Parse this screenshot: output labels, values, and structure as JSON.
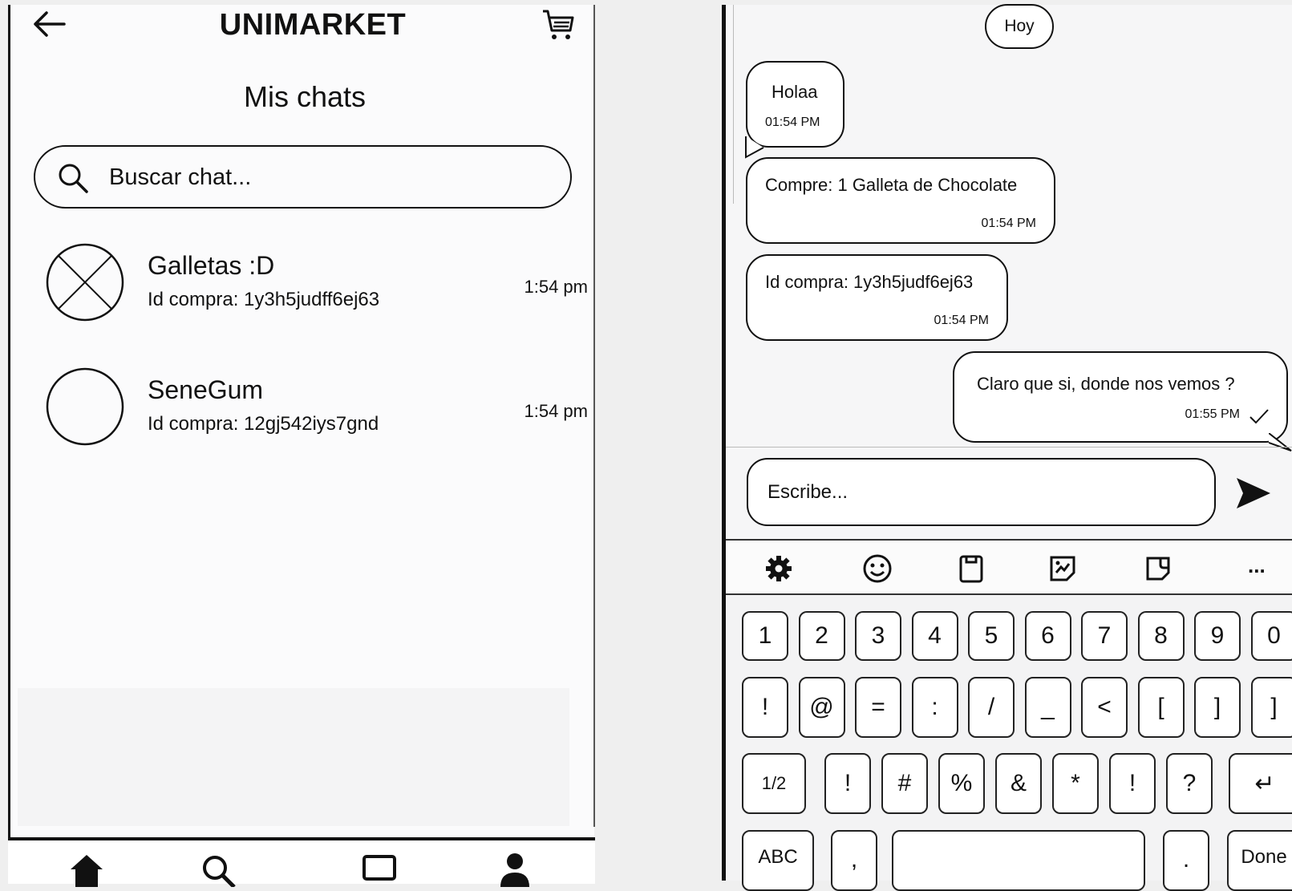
{
  "chat_list": {
    "app_title": "UNIMARKET",
    "page_title": "Mis chats",
    "search": {
      "placeholder": "Buscar chat..."
    },
    "chats": [
      {
        "name": "Galletas :D",
        "subtitle": "Id compra: 1y3h5judff6ej63",
        "time": "1:54 pm",
        "avatar": "placeholder-image-icon"
      },
      {
        "name": "SeneGum",
        "subtitle": "Id compra: 12gj542iys7gnd",
        "time": "1:54 pm",
        "avatar": "empty-avatar-icon"
      }
    ],
    "bottom_nav": [
      "home-icon",
      "search-icon",
      "square-icon",
      "profile-icon"
    ]
  },
  "conversation": {
    "day_label": "Hoy",
    "messages": [
      {
        "text": "Holaa",
        "time": "01:54 PM",
        "side": "incoming"
      },
      {
        "text": "Compre: 1 Galleta de Chocolate",
        "time": "01:54 PM",
        "side": "incoming"
      },
      {
        "text": "Id compra: 1y3h5judf6ej63",
        "time": "01:54 PM",
        "side": "incoming"
      },
      {
        "text": "Claro que si, donde nos vemos ?",
        "time": "01:55 PM",
        "side": "outgoing",
        "status": "check-icon"
      }
    ],
    "compose": {
      "placeholder": "Escribe..."
    }
  },
  "keyboard": {
    "toolbar": [
      "gear-icon",
      "emoji-icon",
      "clipboard-icon",
      "sticker-icon",
      "gif-icon",
      "more-icon"
    ],
    "more_label": "...",
    "row1": [
      "1",
      "2",
      "3",
      "4",
      "5",
      "6",
      "7",
      "8",
      "9",
      "0"
    ],
    "row2": [
      "!",
      "@",
      "=",
      ":",
      "/",
      "_",
      "<",
      "[",
      "]",
      "]"
    ],
    "row3": [
      "1/2",
      "!",
      "#",
      "%",
      "&",
      "*",
      "!",
      "?"
    ],
    "row4": [
      "ABC",
      ",",
      ".",
      "Done"
    ]
  },
  "colors": {
    "outline": "#111111",
    "background": "#fbfbfc"
  }
}
